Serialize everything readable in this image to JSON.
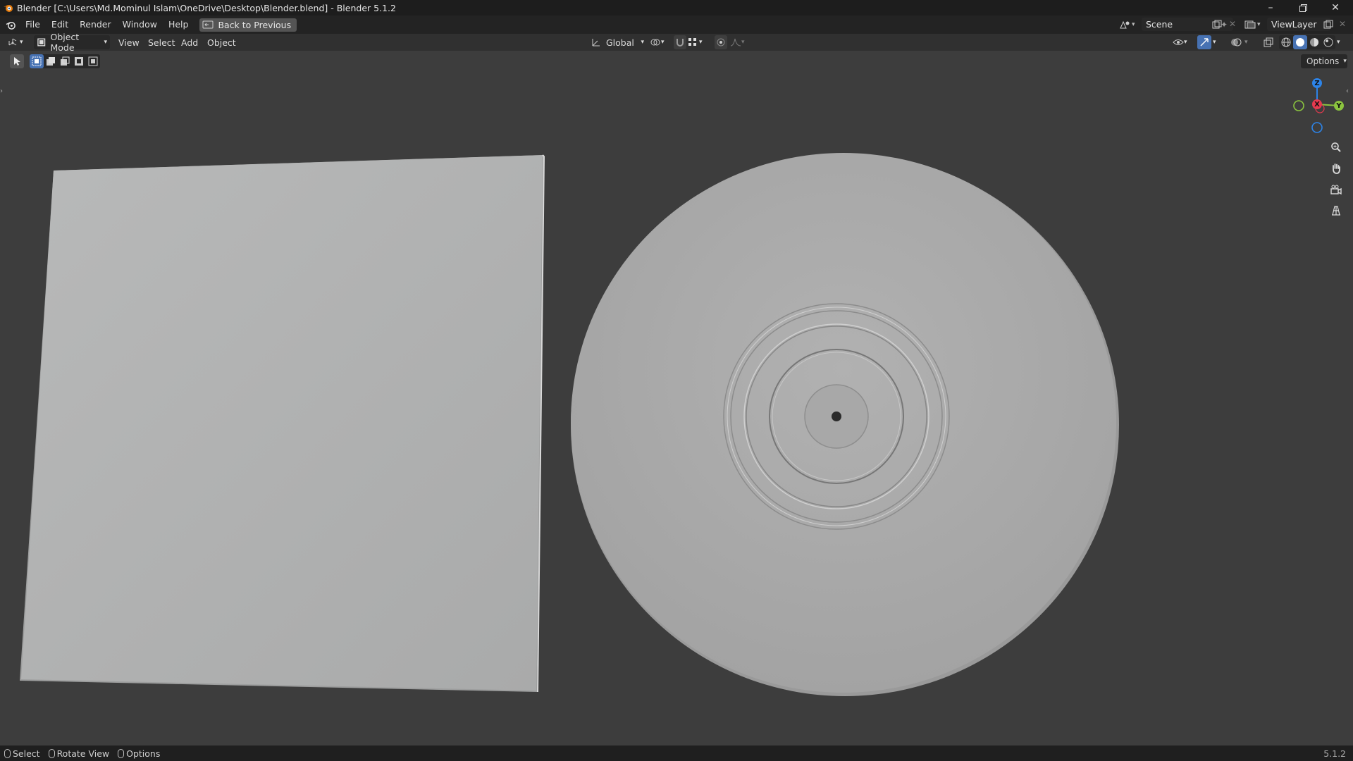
{
  "titlebar": {
    "title": "Blender [C:\\Users\\Md.Mominul Islam\\OneDrive\\Desktop\\Blender.blend] - Blender 5.1.2"
  },
  "menus": [
    "File",
    "Edit",
    "Render",
    "Window",
    "Help"
  ],
  "back_button": "Back to Previous",
  "scene": {
    "label": "Scene"
  },
  "view_layer": {
    "label": "ViewLayer"
  },
  "header": {
    "mode": "Object Mode",
    "view": "View",
    "select": "Select",
    "add": "Add",
    "object": "Object",
    "transform_orientation": "Global",
    "options": "Options"
  },
  "gizmo": {
    "z": "Z",
    "y": "Y",
    "x": "X"
  },
  "statusbar": {
    "select": "Select",
    "rotate": "Rotate View",
    "options": "Options",
    "version": "5.1.2"
  },
  "colors": {
    "viewport_bg": "#3d3d3d",
    "accent": "#4772b3",
    "axis_x": "#e83a4f",
    "axis_y": "#8bc43f",
    "axis_z": "#2d84e8"
  }
}
